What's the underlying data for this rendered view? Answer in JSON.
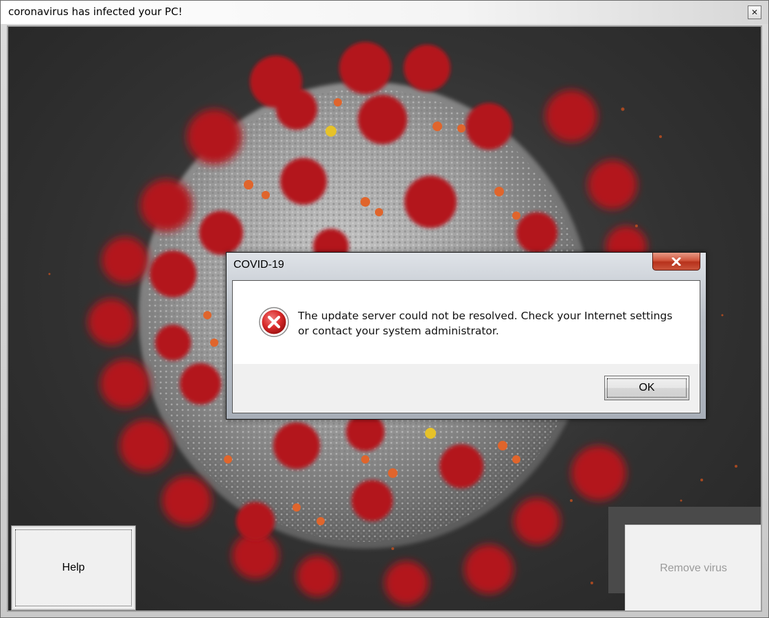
{
  "main_window": {
    "title": "coronavirus has infected your PC!",
    "close_glyph": "✕"
  },
  "dialog": {
    "title": "COVID-19",
    "close_glyph": "✕",
    "icon": "error-icon",
    "message_line1": "The update server could not be resolved. Check your Internet settings",
    "message_line2": "or contact your system administrator.",
    "ok_label": "OK"
  },
  "buttons": {
    "help_label": "Help",
    "remove_label": "Remove virus"
  },
  "colors": {
    "error_red": "#d92b2b",
    "virus_spike_red": "#b3121f",
    "virus_body_gray": "#a9a9a9",
    "background_dark": "#333333"
  }
}
